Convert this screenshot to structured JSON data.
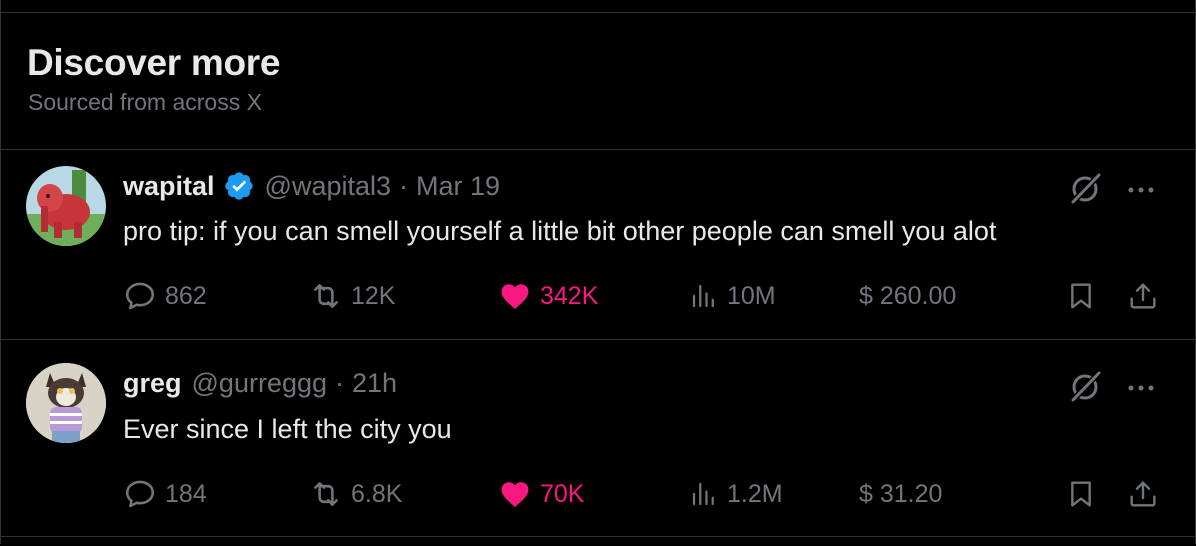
{
  "section": {
    "title": "Discover more",
    "subtitle": "Sourced from across X"
  },
  "colors": {
    "background": "#000000",
    "text_primary": "#e7e9ea",
    "text_secondary": "#71767b",
    "like_active": "#f91880",
    "verified_blue": "#1d9bf0",
    "divider": "#2f3336"
  },
  "posts": [
    {
      "name": "wapital",
      "verified": true,
      "handle": "@wapital3",
      "separator": "·",
      "time": "Mar 19",
      "text": "pro tip: if you can smell yourself a little bit other people can smell you alot",
      "replies": "862",
      "reposts": "12K",
      "likes": "342K",
      "liked": true,
      "views": "10M",
      "tip": "$ 260.00",
      "avatar_icon": "red-elephant-avatar"
    },
    {
      "name": "greg",
      "verified": false,
      "handle": "@gurreggg",
      "separator": "·",
      "time": "21h",
      "text": "Ever since I left the city you",
      "replies": "184",
      "reposts": "6.8K",
      "likes": "70K",
      "liked": true,
      "views": "1.2M",
      "tip": "$ 31.20",
      "avatar_icon": "cat-in-sweater-avatar"
    }
  ]
}
